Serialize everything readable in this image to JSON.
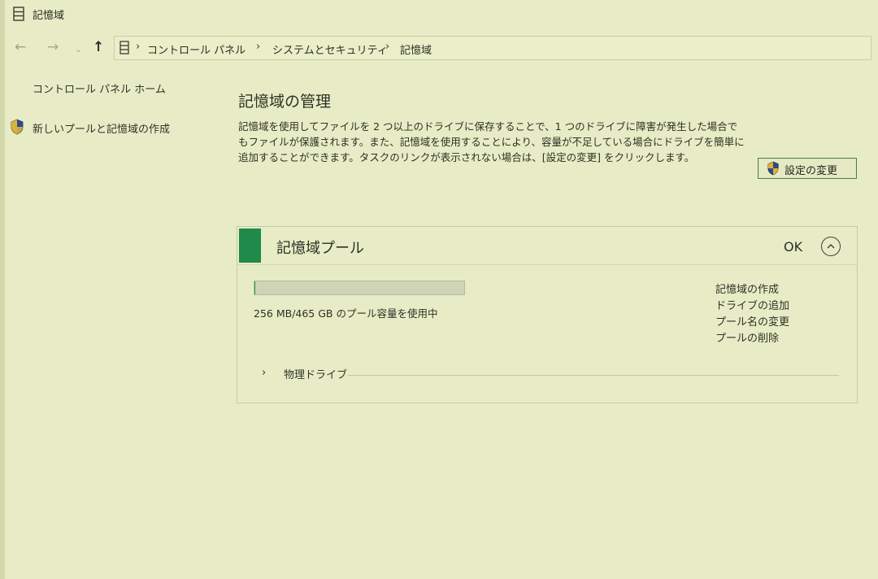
{
  "window": {
    "title": "記憶域"
  },
  "nav": {
    "back_glyph": "←",
    "forward_glyph": "→",
    "recent_glyph": "⌄",
    "up_glyph": "↑",
    "breadcrumbs": [
      "コントロール パネル",
      "システムとセキュリティ",
      "記憶域"
    ],
    "separator": "›"
  },
  "sidebar": {
    "home_link": "コントロール パネル ホーム",
    "new_pool_link": "新しいプールと記憶域の作成"
  },
  "main": {
    "title": "記憶域の管理",
    "description": "記憶域を使用してファイルを 2 つ以上のドライブに保存することで、1 つのドライブに障害が発生した場合でもファイルが保護されます。また、記憶域を使用することにより、容量が不足している場合にドライブを簡単に追加することができます。タスクのリンクが表示されない場合は、[設定の変更] をクリックします。",
    "change_settings_button": "設定の変更"
  },
  "pool": {
    "title": "記憶域プール",
    "status": "OK",
    "usage_fraction": 0.0005,
    "usage_text": "256 MB/465 GB のプール容量を使用中",
    "actions": [
      "記憶域の作成",
      "ドライブの追加",
      "プール名の変更",
      "プールの削除"
    ],
    "physical_drives_label": "物理ドライブ"
  },
  "colors": {
    "accent": "#1f8a4a",
    "background": "#e8ecc6"
  },
  "icons": {
    "title": "storage-icon",
    "address": "storage-icon",
    "uac": "uac-shield-icon",
    "collapse": "chevron-up-icon",
    "expand": "chevron-right-icon"
  }
}
